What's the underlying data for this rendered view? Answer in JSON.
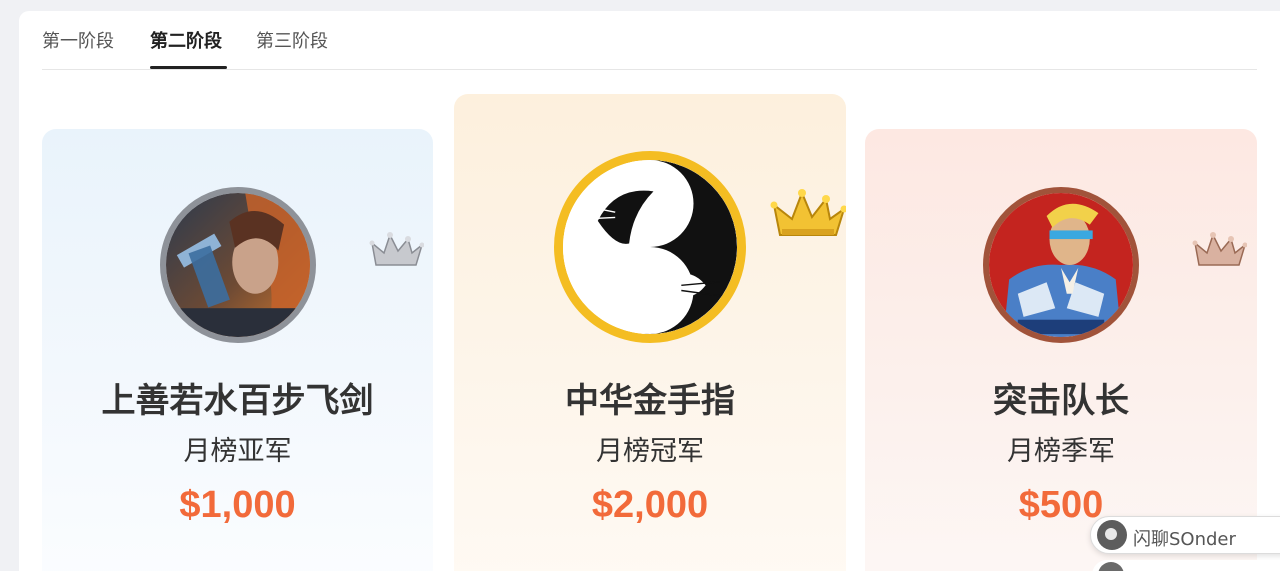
{
  "tabs": [
    {
      "label": "第一阶段",
      "active": false
    },
    {
      "label": "第二阶段",
      "active": true
    },
    {
      "label": "第三阶段",
      "active": false
    }
  ],
  "cards": {
    "silver": {
      "name": "上善若水百步飞剑",
      "rank": "月榜亚军",
      "prize": "$1,000",
      "crown": "silver-crown-icon"
    },
    "gold": {
      "name": "中华金手指",
      "rank": "月榜冠军",
      "prize": "$2,000",
      "crown": "gold-crown-icon"
    },
    "bronze": {
      "name": "突击队长",
      "rank": "月榜季军",
      "prize": "$500",
      "crown": "bronze-crown-icon"
    }
  },
  "floating_widget": {
    "text": "闪聊SOnder"
  },
  "colors": {
    "prize": "#f26a3a",
    "gold_ring": "#f4bd22",
    "silver_ring": "#8e9299",
    "bronze_ring": "#a1533a"
  }
}
